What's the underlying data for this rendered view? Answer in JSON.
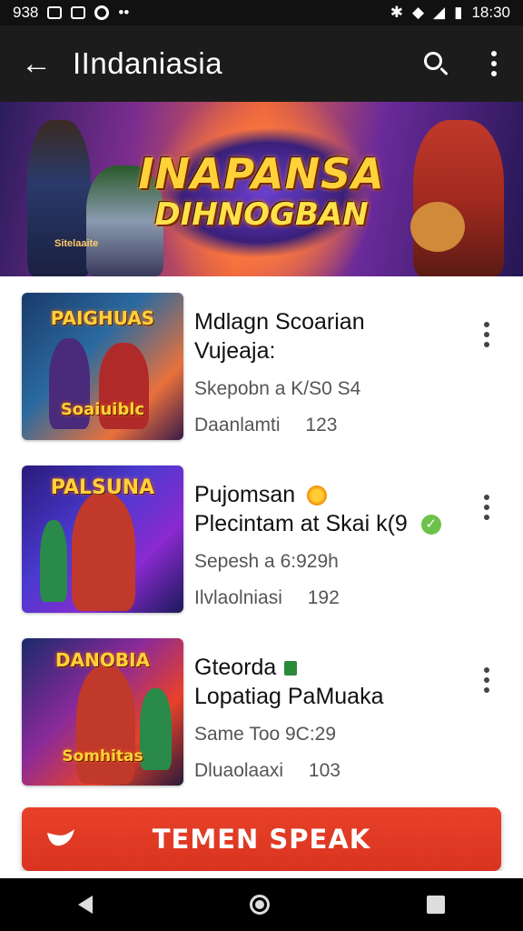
{
  "status_bar": {
    "time_left": "938",
    "time_right": "18:30",
    "icons": [
      "n-icon",
      "box-icon",
      "circle-icon",
      "dots-icon",
      "bluetooth-icon",
      "wifi-icon",
      "signal-icon",
      "battery-icon"
    ]
  },
  "app_bar": {
    "title": "IIndaniasia",
    "back_icon": "arrow-left",
    "search_icon": "search",
    "more_icon": "more-vertical"
  },
  "banner": {
    "logo_line1": "INAPANSA",
    "logo_line2": "DIHNOGBAN",
    "tag": "Sitelaaite"
  },
  "items": [
    {
      "thumb_title_top": "PAIGHUAS",
      "thumb_title_bottom": "Soaiuiblc",
      "title_line1": "Mdlagn Scoarian",
      "title_line2": "Vujeaja:",
      "meta": "Skepobn a K/S0 S4",
      "count_label": "Daanlamti",
      "count_value": "123"
    },
    {
      "thumb_title_top": "PALSUNA",
      "thumb_title_bottom": "",
      "title_line1": "Pujomsan",
      "title_line2": "Plecintam at Skai k(9",
      "meta": "Sepesh a 6:929h",
      "count_label": "Ilvlaolniasi",
      "count_value": "192"
    },
    {
      "thumb_title_top": "DANOBIA",
      "thumb_title_bottom": "Somhitas",
      "title_line1": "Gteorda",
      "title_line2": "Lopatiag PaMuaka",
      "meta": "Same Too 9C:29",
      "count_label": "Dluaolaaxi",
      "count_value": "103"
    }
  ],
  "cta": {
    "label": "TEMEN SPEAK"
  },
  "nav_bar": {
    "icons": [
      "back-triangle",
      "home-circle",
      "recent-square"
    ]
  },
  "colors": {
    "app_bar": "#1c1c1c",
    "status_bar": "#111111",
    "cta": "#e0381f",
    "logo_gold": "#ffd23a"
  }
}
